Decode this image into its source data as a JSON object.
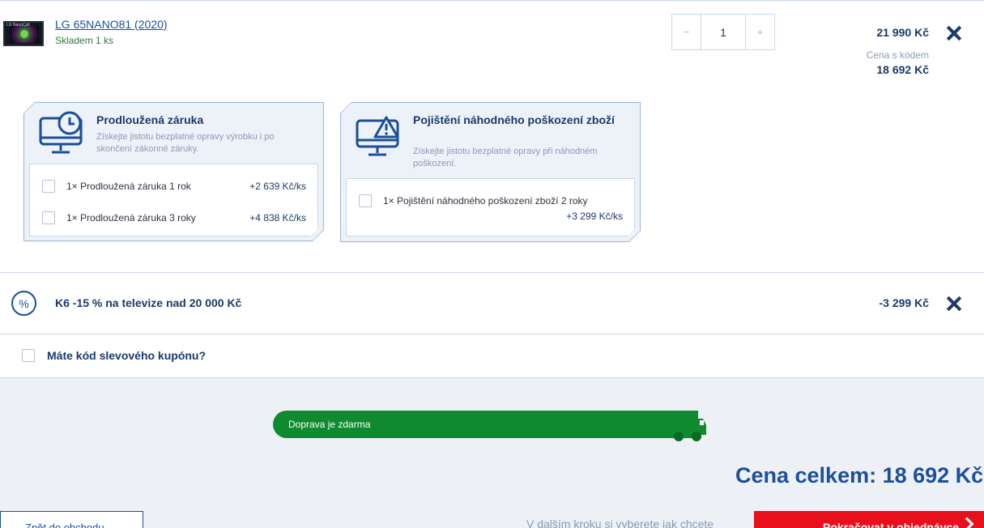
{
  "product": {
    "name": "LG 65NANO81 (2020)",
    "stock": "Skladem 1 ks",
    "thumb_caption": "LG NanoCell",
    "quantity": "1",
    "minus": "−",
    "plus": "+",
    "price": "21 990 Kč",
    "code_price_label": "Cena s kódem",
    "code_price": "18 692 Kč"
  },
  "warranty": {
    "title": "Prodloužená záruka",
    "description": "Získejte jistotu bezplatné opravy výrobku i po skončení zákonné záruky.",
    "options": [
      {
        "label": "1× Prodloužená záruka 1 rok",
        "price": "+2 639 Kč/ks"
      },
      {
        "label": "1× Prodloužená záruka 3 roky",
        "price": "+4 838 Kč/ks"
      }
    ]
  },
  "insurance": {
    "title": "Pojištění náhodného poškození zboží",
    "description": "Získejte jistotu bezplatné opravy při náhodném poškození.",
    "options": [
      {
        "label": "1× Pojištění náhodného poškození zboží 2 roky",
        "price": "+3 299 Kč/ks"
      }
    ]
  },
  "discount": {
    "icon_symbol": "%",
    "label": "K6 -15 % na televize nad 20 000 Kč",
    "amount": "-3 299 Kč"
  },
  "coupon": {
    "label": "Máte kód slevového kupónu?"
  },
  "summary": {
    "shipping": "Doprava je zdarma",
    "total": "Cena celkem: 18 692 Kč",
    "back_label": "Zpět do obchodu",
    "next_note": "V dalším kroku si vyberete jak chcete",
    "next_label": "Pokračovat v objednávce"
  },
  "colors": {
    "brand_blue": "#1b4f9a",
    "dark_blue": "#1b3a6b",
    "shipping_green": "#0f8a2e",
    "cta_red": "#e8101b",
    "panel_bg": "#edf1f6"
  },
  "icons": [
    "clock-monitor-icon",
    "warning-monitor-icon",
    "percent-icon",
    "close-icon",
    "truck-icon",
    "chevron-right-icon"
  ]
}
